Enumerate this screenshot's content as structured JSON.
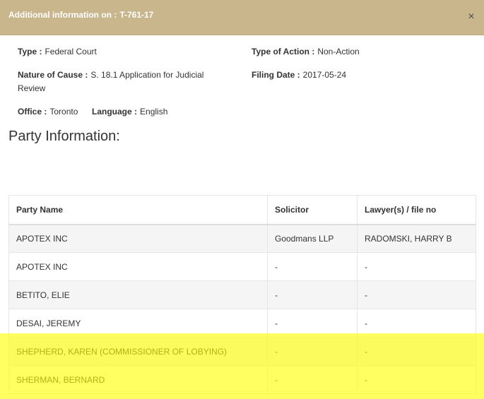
{
  "dialog": {
    "title_prefix": "Additional information on :",
    "case_number": "T-761-17",
    "close_glyph": "×"
  },
  "details": {
    "type": {
      "label": "Type :",
      "value": "Federal Court"
    },
    "type_of_action": {
      "label": "Type of Action :",
      "value": "Non-Action"
    },
    "nature_of_cause": {
      "label": "Nature of Cause :",
      "value": "S. 18.1 Application for Judicial Review"
    },
    "filing_date": {
      "label": "Filing Date :",
      "value": "2017-05-24"
    },
    "office": {
      "label": "Office :",
      "value": "Toronto"
    },
    "language": {
      "label": "Language :",
      "value": "English"
    }
  },
  "party_section": {
    "title": "Party Information:",
    "columns": [
      "Party Name",
      "Solicitor",
      "Lawyer(s) / file no"
    ],
    "rows": [
      {
        "party": "APOTEX INC",
        "solicitor": "Goodmans LLP",
        "lawyer": "RADOMSKI, HARRY B"
      },
      {
        "party": "APOTEX INC",
        "solicitor": "-",
        "lawyer": "-"
      },
      {
        "party": "BETITO, ELIE",
        "solicitor": "-",
        "lawyer": "-"
      },
      {
        "party": "DESAI, JEREMY",
        "solicitor": "-",
        "lawyer": "-"
      },
      {
        "party": "SHEPHERD, KAREN (COMMISSIONER OF LOBYING)",
        "solicitor": "-",
        "lawyer": "-"
      },
      {
        "party": "SHERMAN, BERNARD",
        "solicitor": "-",
        "lawyer": "-"
      }
    ]
  },
  "highlight": {
    "color": "#ffff00",
    "rows_highlighted": [
      "SHEPHERD, KAREN (COMMISSIONER OF LOBYING)",
      "SHERMAN, BERNARD"
    ]
  }
}
